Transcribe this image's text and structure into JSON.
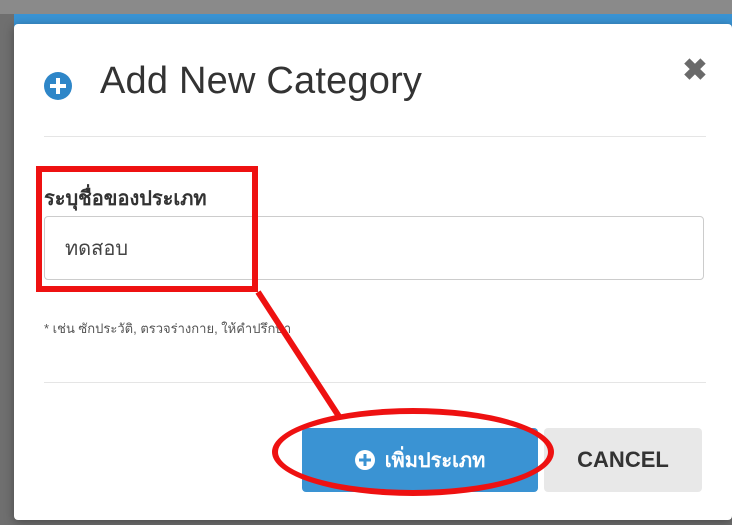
{
  "modal": {
    "title": "Add New Category",
    "close_glyph": "✖",
    "title_icon": "plus-circle-icon",
    "accent_color": "#3a93d3"
  },
  "form": {
    "label": "ระบุชื่อของประเภท",
    "input_value": "ทดสอบ",
    "hint": "* เช่น ซักประวัติ, ตรวจร่างกาย, ให้คำปรึกษา"
  },
  "buttons": {
    "add_label": "เพิ่มประเภท",
    "add_icon": "plus-circle-icon",
    "cancel_label": "CANCEL"
  },
  "annotation": {
    "color": "#ee1111"
  }
}
